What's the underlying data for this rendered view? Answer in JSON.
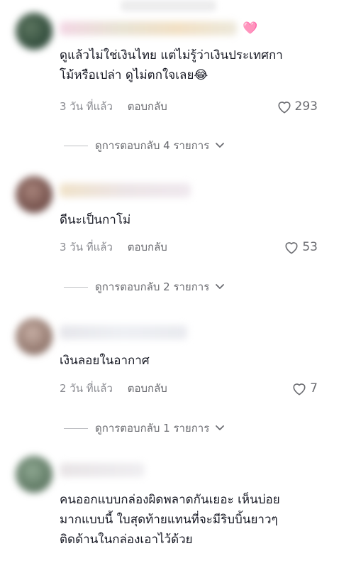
{
  "comments": [
    {
      "text": "ดูแล้วไม่ใช่เงินไทย แต่ไม่รู้ว่าเงินประเทศกา\nโม้หรือเปล่า ดูไม่ตกใจเลย😂",
      "time": "3 วัน ที่แล้ว",
      "reply_label": "ตอบกลับ",
      "likes": "293",
      "view_replies": "ดูการตอบกลับ 4 รายการ"
    },
    {
      "text": "ดีนะเป็นกาโม่",
      "time": "3 วัน ที่แล้ว",
      "reply_label": "ตอบกลับ",
      "likes": "53",
      "view_replies": "ดูการตอบกลับ 2 รายการ"
    },
    {
      "text": "เงินลอยในอากาศ",
      "time": "2 วัน ที่แล้ว",
      "reply_label": "ตอบกลับ",
      "likes": "7",
      "view_replies": "ดูการตอบกลับ 1 รายการ"
    },
    {
      "text": "คนออกแบบกล่องผิดพลาดกันเยอะ เห็นบ่อย\nมากแบบนี้ ใบสุดท้ายแทนที่จะมีริบบิ้นยาวๆ\nติดด้านในกล่องเอาไว้ด้วย"
    }
  ],
  "icons": {
    "heart": "heart-outline-icon",
    "chevron": "chevron-down-icon",
    "name_emoji": "pink-heart-emoji-icon"
  },
  "colors": {
    "text": "#161823",
    "meta": "#8a8b91",
    "pink_heart": "#f7a8d0"
  },
  "name_emoji_glyph": "🩷"
}
